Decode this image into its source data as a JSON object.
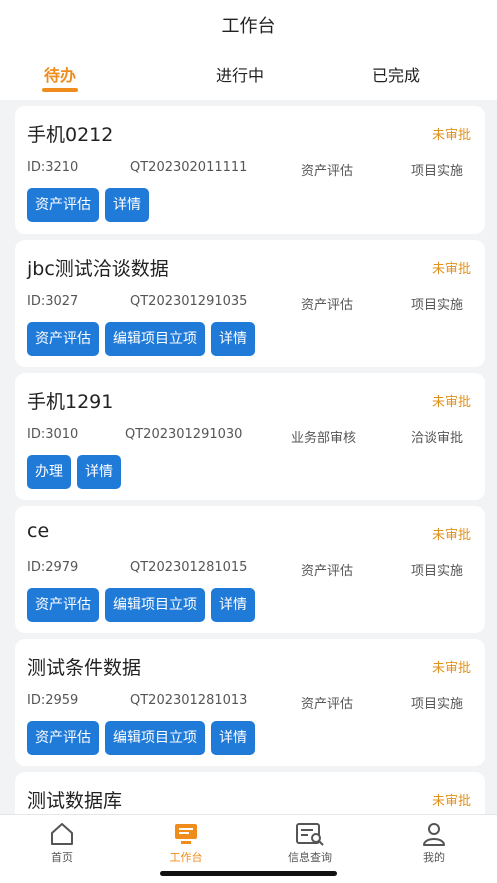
{
  "header": {
    "title": "工作台"
  },
  "tabs": [
    {
      "label": "待办",
      "active": true
    },
    {
      "label": "进行中",
      "active": false
    },
    {
      "label": "已完成",
      "active": false
    }
  ],
  "cards": [
    {
      "title": "手机0212",
      "status": "未审批",
      "id": "ID:3210",
      "code": "QT202302011111",
      "stage": "资产评估",
      "phase": "项目实施",
      "buttons": [
        "资产评估",
        "详情"
      ]
    },
    {
      "title": "jbc测试洽谈数据",
      "status": "未审批",
      "id": "ID:3027",
      "code": "QT202301291035",
      "stage": "资产评估",
      "phase": "项目实施",
      "buttons": [
        "资产评估",
        "编辑项目立项",
        "详情"
      ]
    },
    {
      "title": "手机1291",
      "status": "未审批",
      "id": "ID:3010",
      "code": "QT202301291030",
      "stage": "业务部审核",
      "phase": "洽谈审批",
      "buttons": [
        "办理",
        "详情"
      ]
    },
    {
      "title": "ce",
      "status": "未审批",
      "id": "ID:2979",
      "code": "QT202301281015",
      "stage": "资产评估",
      "phase": "项目实施",
      "buttons": [
        "资产评估",
        "编辑项目立项",
        "详情"
      ]
    },
    {
      "title": "测试条件数据",
      "status": "未审批",
      "id": "ID:2959",
      "code": "QT202301281013",
      "stage": "资产评估",
      "phase": "项目实施",
      "buttons": [
        "资产评估",
        "编辑项目立项",
        "详情"
      ]
    },
    {
      "title": "测试数据库",
      "status": "未审批"
    }
  ],
  "nav": [
    {
      "label": "首页",
      "icon": "home-icon",
      "active": false
    },
    {
      "label": "工作台",
      "icon": "workbench-icon",
      "active": true
    },
    {
      "label": "信息查询",
      "icon": "info-search-icon",
      "active": false
    },
    {
      "label": "我的",
      "icon": "user-icon",
      "active": false
    }
  ],
  "colors": {
    "accent": "#f08c1c",
    "button": "#1f7ad8",
    "status": "#e0921c"
  }
}
